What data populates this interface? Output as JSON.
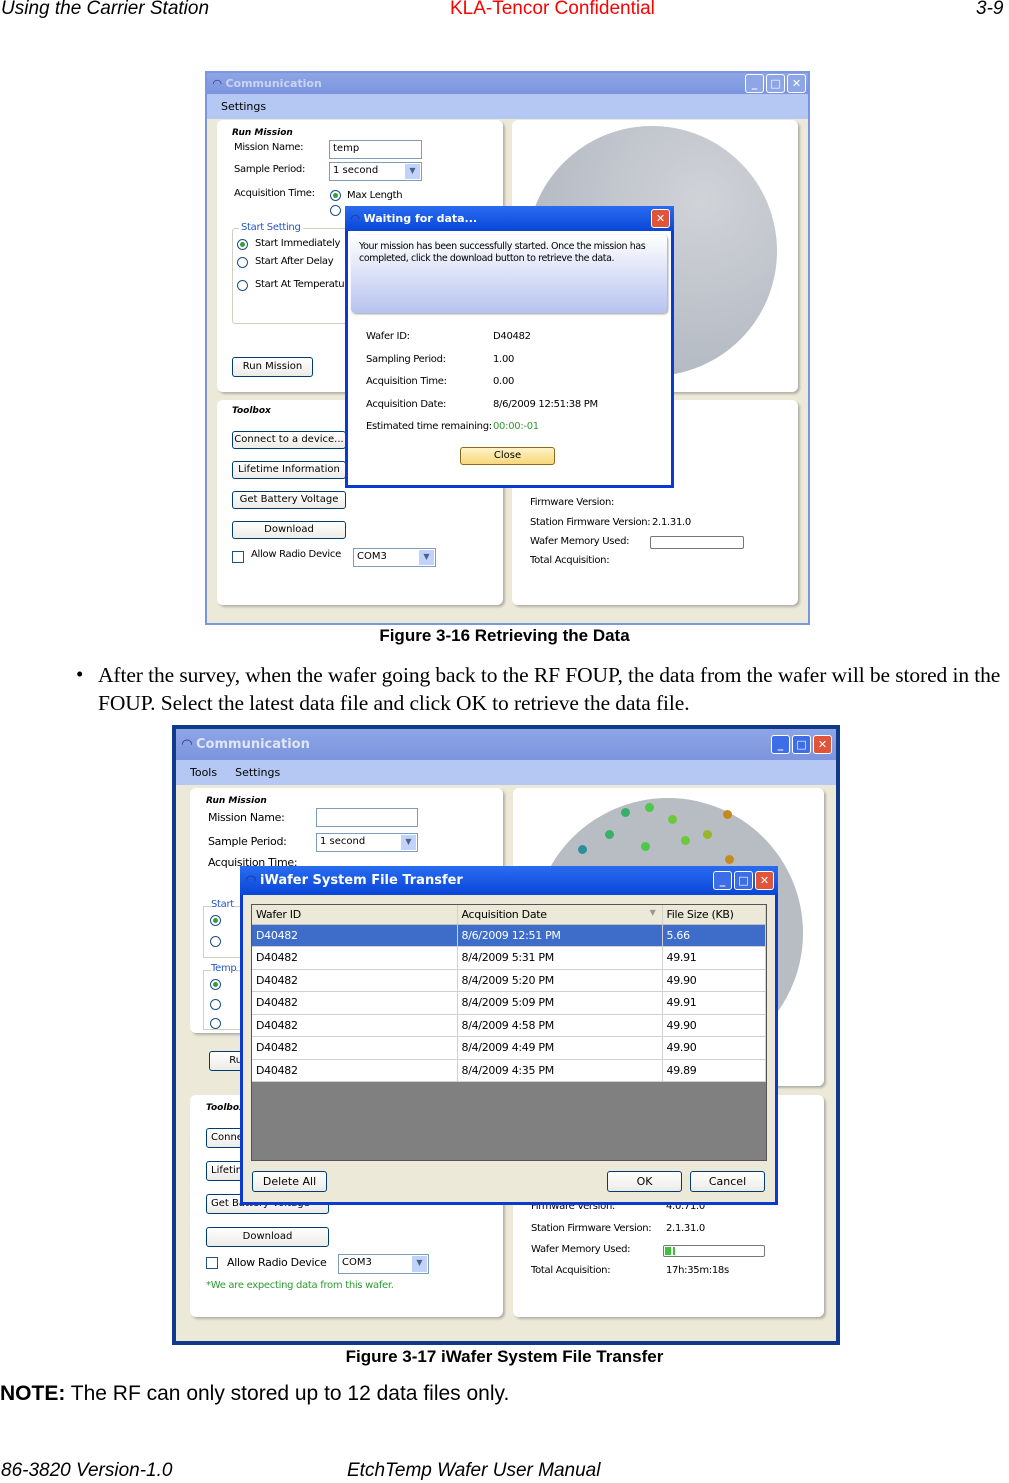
{
  "header": {
    "left": "Using the Carrier Station",
    "center": "KLA-Tencor Confidential",
    "right": "3-9"
  },
  "footer": {
    "left": "86-3820 Version-1.0",
    "center": "EtchTemp Wafer User Manual"
  },
  "colors": {
    "confidential": "#ff0000",
    "title_bar": "#7b94dd",
    "dialog_border": "#0a3ad0",
    "selected_row": "#3d6dc9",
    "green_text": "#2e9a2e"
  },
  "figure1": {
    "caption": "Figure 3-16 Retrieving the Data",
    "window_title": "Communication",
    "menu": [
      "Settings"
    ],
    "run_mission": {
      "title": "Run Mission",
      "mission_name_label": "Mission Name:",
      "mission_name_value": "temp",
      "sample_period_label": "Sample Period:",
      "sample_period_value": "1 second",
      "acq_time_label": "Acquisition Time:",
      "max_length": "Max Length",
      "start_setting": "Start Setting",
      "start_immediately": "Start Immediately",
      "start_after_delay": "Start After Delay",
      "start_at_temperature": "Start At Temperature",
      "run_button": "Run Mission"
    },
    "toolbox": {
      "title": "Toolbox",
      "connect": "Connect to a device...",
      "lifetime": "Lifetime Information",
      "battery": "Get Battery Voltage",
      "download": "Download",
      "allow_radio": "Allow Radio Device",
      "com_port": "COM3"
    },
    "info": {
      "firmware": "Firmware Version:",
      "station_fw_label": "Station Firmware Version:",
      "station_fw_value": "2.1.31.0",
      "memory_label": "Wafer Memory Used:",
      "total_acq_label": "Total Acquisition:"
    },
    "dialog": {
      "title": "Waiting for data...",
      "message": "Your mission has been successfully started.  Once the mission has completed, click the download button to retrieve the data.",
      "rows": [
        {
          "label": "Wafer ID:",
          "value": "D40482"
        },
        {
          "label": "Sampling Period:",
          "value": "1.00"
        },
        {
          "label": "Acquisition Time:",
          "value": "0.00"
        },
        {
          "label": "Acquisition Date:",
          "value": "8/6/2009 12:51:38 PM"
        },
        {
          "label": "Estimated time remaining:",
          "value": "00:00:-01"
        }
      ],
      "close_button": "Close"
    }
  },
  "bullet": "After the survey, when the wafer going back to the RF FOUP, the data from the wafer will be stored in the FOUP. Select the latest data file and click OK to retrieve the data file.",
  "figure2": {
    "caption": "Figure 3-17 iWafer System File Transfer",
    "window_title": "Communication",
    "menu": [
      "Tools",
      "Settings"
    ],
    "run_mission": {
      "title": "Run Mission",
      "mission_name_label": "Mission Name:",
      "mission_name_value": "",
      "sample_period_label": "Sample Period:",
      "sample_period_value": "1 second",
      "acq_time_label": "Acquisition Time:",
      "start": "Start",
      "temp": "Temp",
      "run_button": "Run Mission"
    },
    "toolbox": {
      "title": "Toolbox",
      "connect": "Connect to a device...",
      "lifetime": "Lifetime Information",
      "battery": "Get Battery Voltage",
      "download": "Download",
      "allow_radio": "Allow Radio Device",
      "com_port": "COM3",
      "note": "*We are expecting data from this wafer."
    },
    "info": {
      "firmware_label": "Firmware Version:",
      "firmware_value": "4.0.71.0",
      "station_fw_label": "Station Firmware Version:",
      "station_fw_value": "2.1.31.0",
      "memory_label": "Wafer Memory Used:",
      "memory_used_percent": 10,
      "total_acq_label": "Total Acquisition:",
      "total_acq_value": "17h:35m:18s"
    },
    "dialog": {
      "title": "iWafer System File Transfer",
      "columns": [
        "Wafer ID",
        "Acquisition Date",
        "File Size (KB)"
      ],
      "rows": [
        [
          "D40482",
          "8/6/2009 12:51 PM",
          "5.66"
        ],
        [
          "D40482",
          "8/4/2009 5:31 PM",
          "49.91"
        ],
        [
          "D40482",
          "8/4/2009 5:20 PM",
          "49.90"
        ],
        [
          "D40482",
          "8/4/2009 5:09 PM",
          "49.91"
        ],
        [
          "D40482",
          "8/4/2009 4:58 PM",
          "49.90"
        ],
        [
          "D40482",
          "8/4/2009 4:49 PM",
          "49.90"
        ],
        [
          "D40482",
          "8/4/2009 4:35 PM",
          "49.89"
        ]
      ],
      "selected_row": 0,
      "delete_all": "Delete All",
      "ok": "OK",
      "cancel": "Cancel"
    }
  },
  "note": {
    "label": "NOTE:",
    "text": " The RF can only stored up to 12 data files only."
  }
}
